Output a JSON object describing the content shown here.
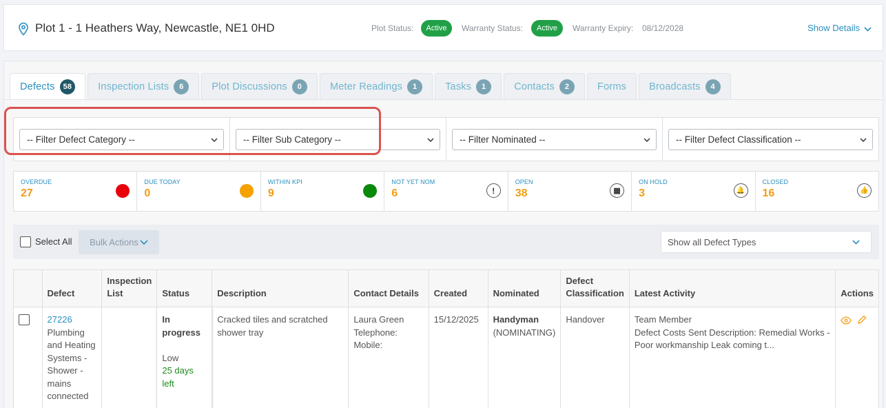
{
  "header": {
    "plot_title": "Plot 1 - 1 Heathers Way, Newcastle, NE1 0HD",
    "plot_status_label": "Plot Status:",
    "plot_status": "Active",
    "warranty_status_label": "Warranty Status:",
    "warranty_status": "Active",
    "warranty_expiry_label": "Warranty Expiry:",
    "warranty_expiry": "08/12/2028",
    "show_details": "Show Details",
    "status_color": "#21a048"
  },
  "tabs": [
    {
      "label": "Defects",
      "count": "58",
      "active": true
    },
    {
      "label": "Inspection Lists",
      "count": "6"
    },
    {
      "label": "Plot Discussions",
      "count": "0"
    },
    {
      "label": "Meter Readings",
      "count": "1"
    },
    {
      "label": "Tasks",
      "count": "1"
    },
    {
      "label": "Contacts",
      "count": "2"
    },
    {
      "label": "Forms",
      "count": ""
    },
    {
      "label": "Broadcasts",
      "count": "4"
    }
  ],
  "filters": [
    "-- Filter Defect Category --",
    "-- Filter Sub Category --",
    "-- Filter Nominated --",
    "-- Filter Defect Classification --"
  ],
  "kpis": [
    {
      "label": "OVERDUE",
      "value": "27",
      "indicator": "red-dot",
      "color": "#e8000b"
    },
    {
      "label": "DUE TODAY",
      "value": "0",
      "indicator": "amber-dot",
      "color": "#f5a100"
    },
    {
      "label": "WITHIN KPI",
      "value": "9",
      "indicator": "green-dot",
      "color": "#0a8a0a"
    },
    {
      "label": "NOT YET NOM",
      "value": "6",
      "indicator": "exclamation-icon",
      "glyph": "!"
    },
    {
      "label": "OPEN",
      "value": "38",
      "indicator": "building-icon",
      "glyph": "▦"
    },
    {
      "label": "ON HOLD",
      "value": "3",
      "indicator": "bell-icon",
      "glyph": "🔔"
    },
    {
      "label": "CLOSED",
      "value": "16",
      "indicator": "thumbs-up-icon",
      "glyph": "👍"
    }
  ],
  "toolbar": {
    "select_all": "Select All",
    "bulk_actions": "Bulk Actions",
    "defect_types": "Show all Defect Types"
  },
  "table": {
    "headers": [
      "",
      "Defect",
      "Inspection List",
      "Status",
      "Description",
      "Contact Details",
      "Created",
      "Nominated",
      "Defect Classification",
      "Latest Activity",
      "Actions"
    ],
    "rows": [
      {
        "defect_id": "27226",
        "defect_text": "Plumbing and Heating Systems - Shower - mains connected",
        "inspection_list": "",
        "status": "In progress",
        "priority": "Low",
        "due": "25 days left",
        "description": "Cracked tiles and scratched shower tray",
        "contact_name": "Laura Green",
        "contact_tel": "Telephone:",
        "contact_mobile": "Mobile:",
        "created": "15/12/2025",
        "nominated": "Handyman",
        "nominated_state": "(NOMINATING)",
        "classification": "Handover",
        "activity_by": "Team Member",
        "activity_text": "Defect Costs Sent Description: Remedial Works - Poor workmanship Leak coming t..."
      }
    ]
  },
  "colors": {
    "accent": "#2a8fc0",
    "kpi_value": "#f39c12",
    "highlight": "#d9534f"
  }
}
